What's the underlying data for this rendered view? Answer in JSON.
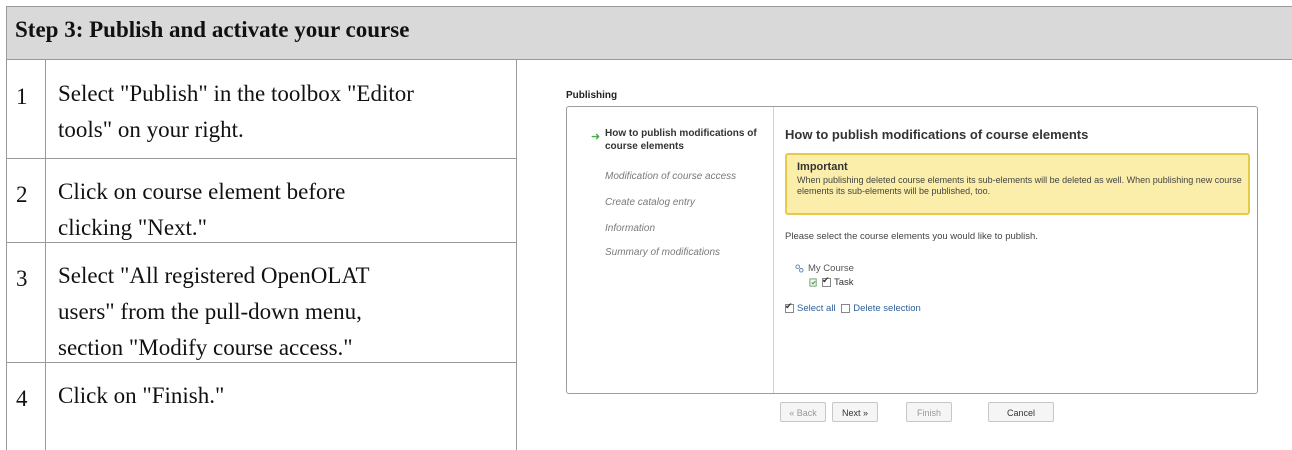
{
  "header": {
    "title": "Step 3: Publish and activate your course"
  },
  "steps": [
    {
      "num": "1",
      "line1": "Select \"Publish\" in the toolbox \"Editor",
      "line2": "tools\" on your right."
    },
    {
      "num": "2",
      "line1": "Click on course element before",
      "line2": "clicking \"Next.\""
    },
    {
      "num": "3",
      "line1": "Select \"All registered OpenOLAT",
      "line2": "users\" from the pull-down menu,",
      "line3": "section \"Modify course access.\""
    },
    {
      "num": "4",
      "line1": "Click on \"Finish.\""
    }
  ],
  "screenshot": {
    "title": "Publishing",
    "nav": {
      "active_line1": "How to publish modifications of",
      "active_line2": "course elements",
      "items": [
        "Modification of course access",
        "Create catalog entry",
        "Information",
        "Summary of modifications"
      ]
    },
    "content": {
      "title": "How to publish modifications of course elements",
      "warning_title": "Important",
      "warning_text": "When publishing deleted course elements its sub-elements will be deleted as well. When publishing new course elements its sub-elements will be published, too.",
      "prompt": "Please select the course elements you would like to publish.",
      "tree_root": "My Course",
      "tree_child": "Task",
      "select_all": "Select all",
      "delete_selection": "Delete selection"
    },
    "buttons": {
      "back": "« Back",
      "next": "Next »",
      "finish": "Finish",
      "cancel": "Cancel"
    }
  }
}
